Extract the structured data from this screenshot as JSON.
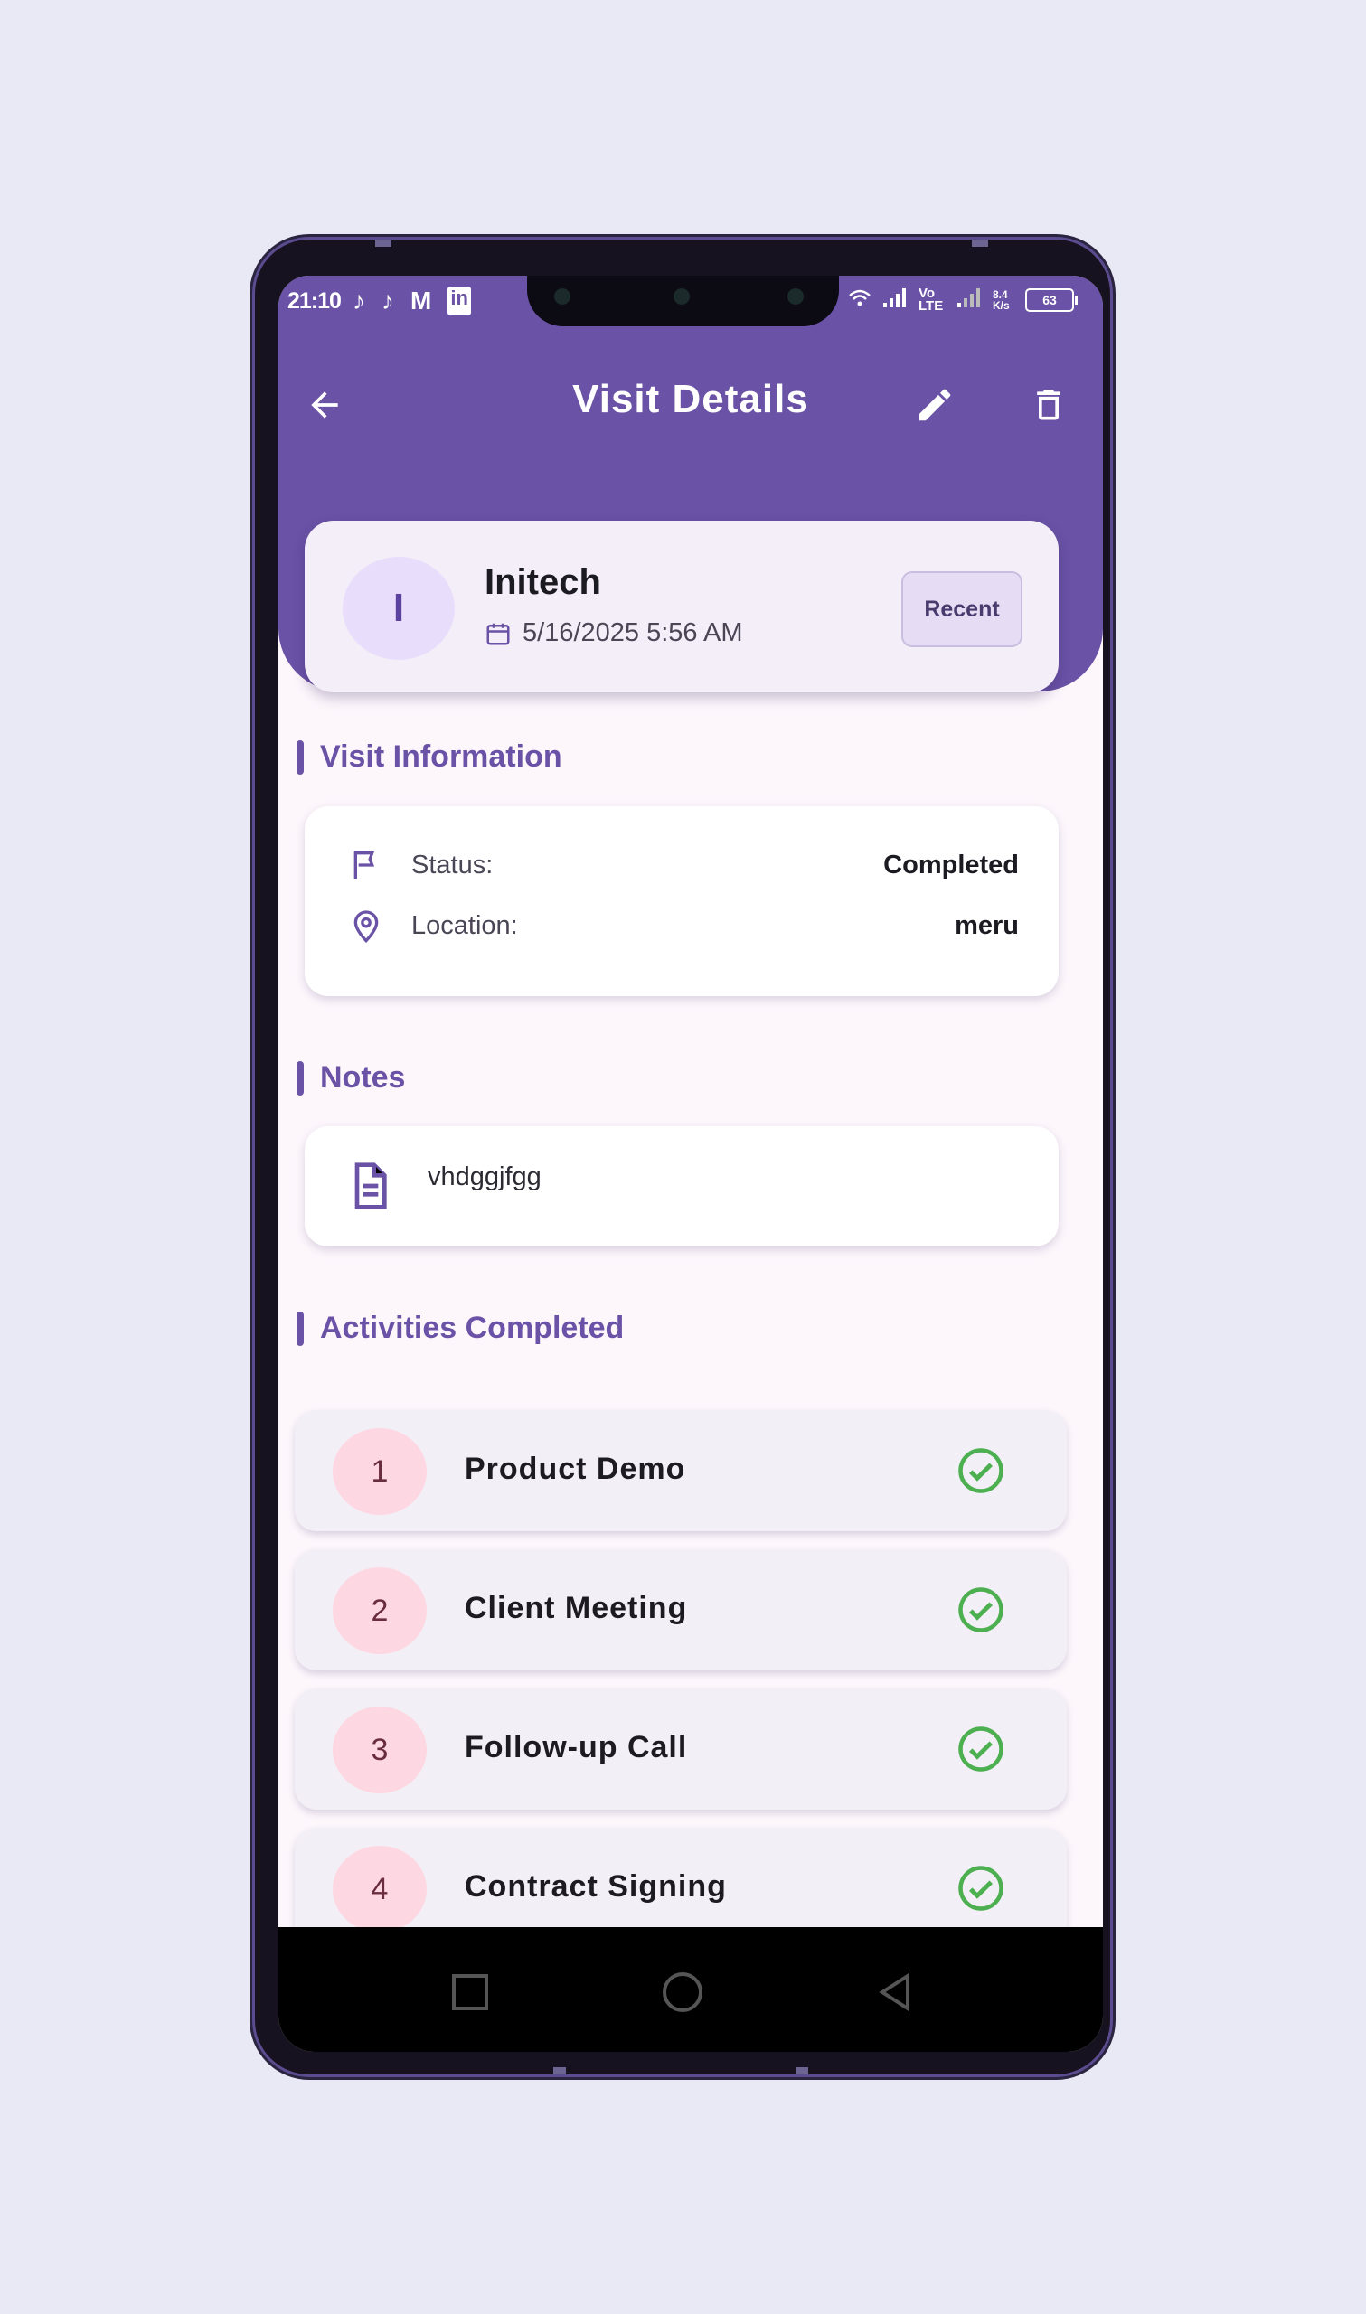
{
  "status_bar": {
    "time": "21:10",
    "left_icons": [
      "tiktok-icon",
      "tiktok-icon",
      "gmail-icon",
      "linkedin-icon"
    ],
    "right_icons": [
      "wifi-icon",
      "signal-icon",
      "volte-icon",
      "signal-icon",
      "data-speed-icon"
    ],
    "network_label": "Vo LTE",
    "data_speed": "8.4 K/s",
    "battery": "63"
  },
  "app_bar": {
    "title": "Visit Details",
    "back_icon": "arrow-left-icon",
    "edit_icon": "pencil-icon",
    "delete_icon": "trash-icon"
  },
  "company": {
    "initial": "I",
    "name": "Initech",
    "date": "5/16/2025 5:56 AM",
    "badge": "Recent"
  },
  "sections": {
    "visit_info": "Visit Information",
    "notes": "Notes",
    "activities": "Activities Completed"
  },
  "visit_info": {
    "status_label": "Status:",
    "status_value": "Completed",
    "location_label": "Location:",
    "location_value": "meru"
  },
  "notes": {
    "text": "vhdggjfgg"
  },
  "activities": [
    {
      "number": "1",
      "label": "Product Demo"
    },
    {
      "number": "2",
      "label": "Client Meeting"
    },
    {
      "number": "3",
      "label": "Follow-up Call"
    },
    {
      "number": "4",
      "label": "Contract Signing"
    }
  ],
  "colors": {
    "primary": "#6a52a6",
    "check": "#4caf50",
    "background": "#fdf7fc"
  },
  "nav_bar": [
    "square-icon",
    "circle-icon",
    "triangle-back-icon"
  ]
}
